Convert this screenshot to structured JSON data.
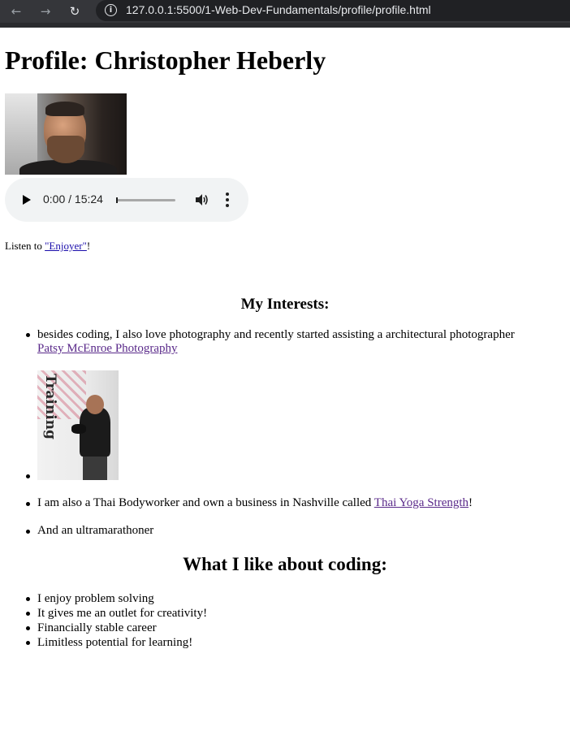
{
  "browser": {
    "url": "127.0.0.1:5500/1-Web-Dev-Fundamentals/profile/profile.html",
    "back_icon": "arrow-left-icon",
    "forward_icon": "arrow-right-icon",
    "reload_icon": "reload-icon",
    "info_icon": "info-icon"
  },
  "page": {
    "title": "Profile: Christopher Heberly",
    "audio": {
      "time": "0:00 / 15:24",
      "progress": 0
    },
    "listen": {
      "prefix": "Listen to ",
      "link": "\"Enjoyer\"",
      "suffix": "!"
    },
    "interests": {
      "heading": "My Interests:",
      "items": [
        {
          "text": "besides coding, I also love photography and recently started assisting a architectural photographer",
          "link": "Patsy McEnroe Photography"
        },
        {
          "image_text": "Training"
        },
        {
          "text": "I am also a Thai Bodyworker and own a business in Nashville called ",
          "link": "Thai Yoga Strength",
          "suffix": "!"
        },
        {
          "text": "And an ultramarathoner"
        }
      ]
    },
    "coding": {
      "heading": "What I like about coding:",
      "items": [
        "I enjoy problem solving",
        "It gives me an outlet for creativity!",
        "Financially stable career",
        "Limitless potential for learning!"
      ]
    }
  }
}
